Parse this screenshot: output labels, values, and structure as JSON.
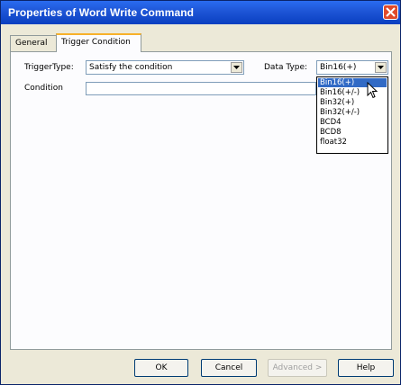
{
  "window": {
    "title": "Properties of Word Write Command"
  },
  "tabs": [
    {
      "label": "General"
    },
    {
      "label": "Trigger Condition"
    }
  ],
  "trigger_condition": {
    "trigger_type_label": "TriggerType:",
    "trigger_type_value": "Satisfy the condition",
    "data_type_label": "Data Type:",
    "data_type_value": "Bin16(+)",
    "condition_label": "Condition",
    "condition_value": ""
  },
  "data_type_options": [
    "Bin16(+)",
    "Bin16(+/-)",
    "Bin32(+)",
    "Bin32(+/-)",
    "BCD4",
    "BCD8",
    "float32"
  ],
  "buttons": {
    "ok": "OK",
    "cancel": "Cancel",
    "advanced": "Advanced >",
    "help": "Help"
  },
  "colors": {
    "titlebar": "#1f57d8",
    "selected_option": "#316ac5",
    "tab_highlight": "#f7b12a"
  }
}
